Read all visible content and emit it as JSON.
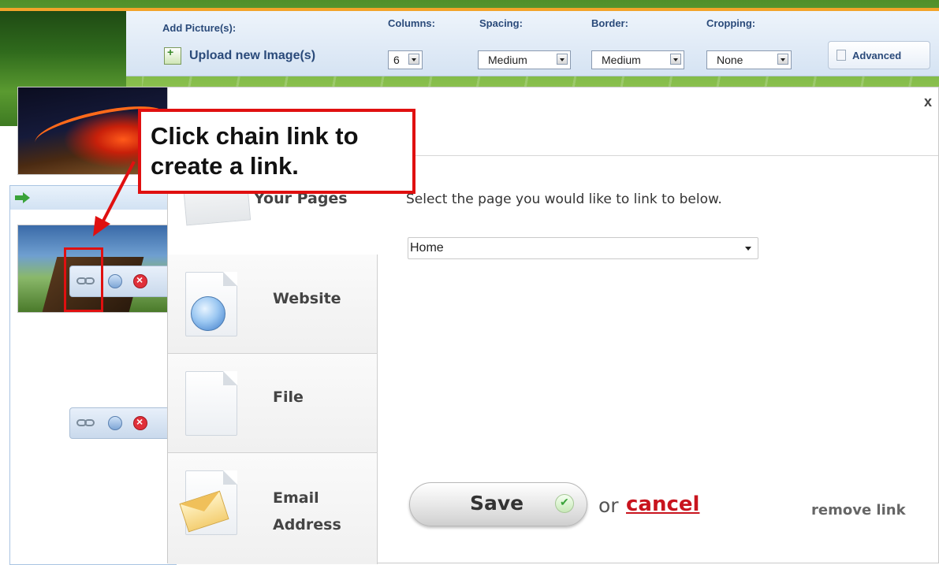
{
  "toolbar": {
    "add_pictures_label": "Add Picture(s):",
    "upload_label": "Upload new Image(s)",
    "columns_label": "Columns:",
    "columns_value": "6",
    "spacing_label": "Spacing:",
    "spacing_value": "Medium",
    "border_label": "Border:",
    "border_value": "Medium",
    "cropping_label": "Cropping:",
    "cropping_value": "None",
    "advanced_label": "Advanced"
  },
  "callout": {
    "text": "Click chain link to create a link."
  },
  "modal": {
    "close_label": "x",
    "tabs": [
      {
        "label": "Your Pages"
      },
      {
        "label": "Website"
      },
      {
        "label": "File"
      },
      {
        "label": "Email Address"
      }
    ],
    "instruction": "Select the page you would like to link to below.",
    "page_select_value": "Home",
    "save_label": "Save",
    "or_label": "or",
    "cancel_label": "cancel",
    "remove_link_label": "remove link"
  },
  "colors": {
    "annotation_red": "#e01010",
    "cancel_red": "#c8141e",
    "toolbar_blue": "#d5e3f3",
    "accent_orange": "#f2a42a"
  },
  "icons": [
    "upload-image-icon",
    "dropdown-arrow-icon",
    "advanced-checkbox-icon",
    "chain-link-icon",
    "comment-icon",
    "delete-icon",
    "globe-icon",
    "file-icon",
    "envelope-icon",
    "checkmark-icon",
    "green-arrow-icon"
  ]
}
